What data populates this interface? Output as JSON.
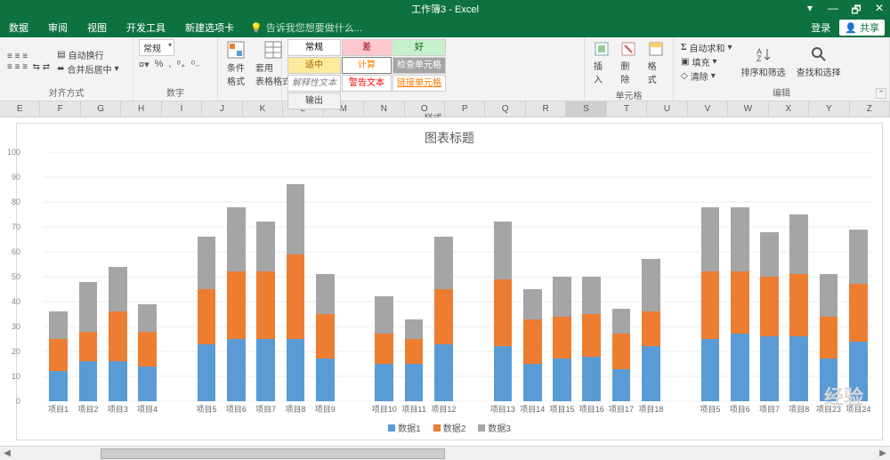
{
  "window": {
    "title": "工作簿3 - Excel",
    "login": "登录",
    "share": "共享",
    "min": "—",
    "max": "❐",
    "close": "✕",
    "restore": "🗗"
  },
  "menu": {
    "tabs": [
      "数据",
      "审阅",
      "视图",
      "开发工具",
      "新建选项卡"
    ],
    "tell_icon": "💡",
    "tell": "告诉我您想要做什么..."
  },
  "ribbon": {
    "align": {
      "label": "对齐方式",
      "wrap": "自动换行",
      "merge": "合并后居中"
    },
    "number": {
      "label": "数字",
      "format": "常规",
      "pct": "%",
      "comma": ",",
      "inc": ".0→.00",
      "dec": ".00→.0"
    },
    "cond": {
      "label": "条件格式",
      "table": "套用\n表格格式"
    },
    "styles": {
      "label": "样式",
      "cells": [
        {
          "t": "常规",
          "bg": "#fff",
          "c": "#000"
        },
        {
          "t": "差",
          "bg": "#ffc7ce",
          "c": "#9c0006"
        },
        {
          "t": "好",
          "bg": "#c6efce",
          "c": "#006100"
        },
        {
          "t": "适中",
          "bg": "#ffeb9c",
          "c": "#9c6500"
        },
        {
          "t": "计算",
          "bg": "#fff",
          "c": "#fa7d00",
          "b": "#7f7f7f"
        },
        {
          "t": "检查单元格",
          "bg": "#a5a5a5",
          "c": "#fff"
        },
        {
          "t": "解释性文本",
          "bg": "#fff",
          "c": "#7f7f7f",
          "i": true
        },
        {
          "t": "警告文本",
          "bg": "#fff",
          "c": "#ff0000"
        },
        {
          "t": "链接单元格",
          "bg": "#fff",
          "c": "#fa7d00",
          "u": true
        },
        {
          "t": "输出",
          "bg": "#f2f2f2",
          "c": "#3f3f3f"
        }
      ]
    },
    "cells": {
      "label": "单元格",
      "insert": "插入",
      "delete": "删除",
      "format": "格式"
    },
    "edit": {
      "label": "编辑",
      "sum": "自动求和",
      "fill": "填充",
      "clear": "清除",
      "sort": "排序和筛选",
      "find": "查找和选择"
    }
  },
  "columns": [
    "E",
    "F",
    "G",
    "H",
    "I",
    "J",
    "K",
    "L",
    "M",
    "N",
    "O",
    "P",
    "Q",
    "R",
    "S",
    "T",
    "U",
    "V",
    "W",
    "X",
    "Y",
    "Z"
  ],
  "selcol": "S",
  "chart_data": {
    "type": "bar",
    "stacked": true,
    "title": "图表标题",
    "ylim": [
      0,
      100
    ],
    "yticks": [
      0,
      10,
      20,
      30,
      40,
      50,
      60,
      70,
      80,
      90,
      100
    ],
    "series_names": [
      "数据1",
      "数据2",
      "数据3"
    ],
    "colors": [
      "#5b9bd5",
      "#ed7d31",
      "#a5a5a5"
    ],
    "categories": [
      "项目1",
      "项目2",
      "项目3",
      "项目4",
      "项目5",
      "项目6",
      "项目7",
      "项目8",
      "项目9",
      "项目10",
      "项目11",
      "项目12",
      "项目13",
      "项目14",
      "项目15",
      "项目16",
      "项目17",
      "项目18",
      "项目5",
      "项目6",
      "项目7",
      "项目8",
      "项目23",
      "项目24"
    ],
    "gaps_after": [
      3,
      8,
      11,
      17
    ],
    "series": [
      {
        "name": "数据1",
        "values": [
          12,
          16,
          16,
          14,
          23,
          25,
          25,
          25,
          17,
          15,
          15,
          23,
          22,
          15,
          17,
          18,
          13,
          22,
          25,
          27,
          26,
          26,
          17,
          24
        ]
      },
      {
        "name": "数据2",
        "values": [
          13,
          12,
          20,
          14,
          22,
          27,
          27,
          34,
          18,
          12,
          10,
          22,
          27,
          18,
          17,
          17,
          14,
          14,
          27,
          25,
          24,
          25,
          17,
          23
        ]
      },
      {
        "name": "数据3",
        "values": [
          11,
          20,
          18,
          11,
          21,
          26,
          20,
          28,
          16,
          15,
          8,
          21,
          23,
          12,
          16,
          15,
          10,
          21,
          26,
          26,
          18,
          24,
          17,
          22
        ]
      }
    ]
  },
  "watermark": "经验"
}
